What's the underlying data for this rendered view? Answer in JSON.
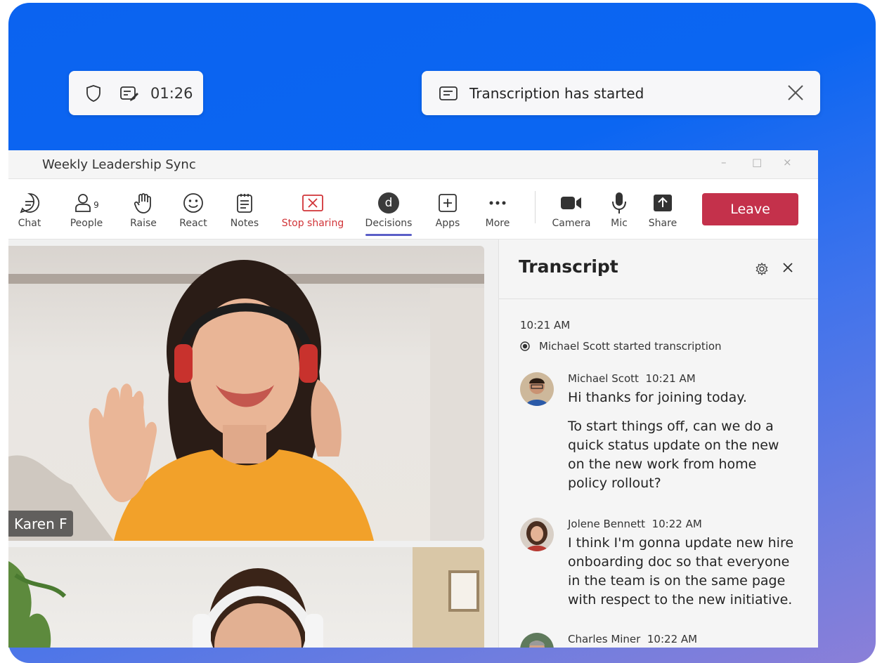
{
  "top": {
    "timer": "01:26",
    "toast_text": "Transcription has started"
  },
  "window": {
    "title": "Weekly Leadership Sync",
    "controls": [
      "–",
      "□",
      "×"
    ]
  },
  "toolbar": {
    "people_count": "9",
    "items": [
      {
        "label": "Chat"
      },
      {
        "label": "People"
      },
      {
        "label": "Raise"
      },
      {
        "label": "React"
      },
      {
        "label": "Notes"
      },
      {
        "label": "Stop sharing"
      },
      {
        "label": "Decisions",
        "badge": "d"
      },
      {
        "label": "Apps"
      },
      {
        "label": "More"
      },
      {
        "label": "Camera"
      },
      {
        "label": "Mic"
      },
      {
        "label": "Share"
      }
    ],
    "leave_label": "Leave"
  },
  "video": {
    "participant_name": "Karen F"
  },
  "transcript": {
    "title": "Transcript",
    "start_time": "10:21 AM",
    "system_message": "Michael Scott started transcription",
    "messages": [
      {
        "speaker": "Michael Scott",
        "time": "10:21 AM",
        "paragraphs": [
          "Hi thanks for joining today.",
          "To start things off, can we do a quick status update on the new on the new work from home policy rollout?"
        ]
      },
      {
        "speaker": "Jolene Bennett",
        "time": "10:22 AM",
        "paragraphs": [
          "I think I'm gonna update new hire onboarding doc so that everyone in the team is on the same page with respect to the new initiative."
        ]
      },
      {
        "speaker": "Charles Miner",
        "time": "10:22 AM",
        "paragraphs": []
      }
    ]
  },
  "colors": {
    "background_blue": "#0b63f0",
    "leave_red": "#c4314b",
    "stop_sharing_red": "#d13438",
    "active_underline": "#5b5fc7"
  }
}
